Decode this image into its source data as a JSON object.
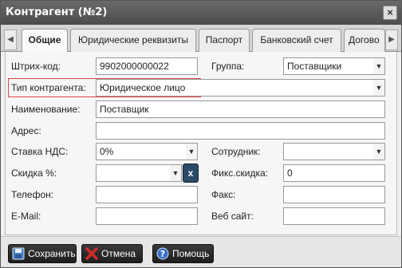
{
  "window": {
    "title": "Контрагент (№2)"
  },
  "tabs": [
    {
      "label": "Общие"
    },
    {
      "label": "Юридические реквизиты"
    },
    {
      "label": "Паспорт"
    },
    {
      "label": "Банковский счет"
    },
    {
      "label": "Догово"
    }
  ],
  "form": {
    "barcode_label": "Штрих-код:",
    "barcode_value": "9902000000022",
    "group_label": "Группа:",
    "group_value": "Поставщики",
    "type_label": "Тип контрагента:",
    "type_value": "Юридическое лицо",
    "name_label": "Наименование:",
    "name_value": "Поставщик",
    "address_label": "Адрес:",
    "address_value": "",
    "vat_label": "Ставка НДС:",
    "vat_value": "0%",
    "employee_label": "Сотрудник:",
    "employee_value": "",
    "discount_label": "Скидка %:",
    "discount_value": "",
    "discount_clear": "x",
    "fixed_discount_label": "Фикс.скидка:",
    "fixed_discount_value": "0",
    "phone_label": "Телефон:",
    "phone_value": "",
    "fax_label": "Факс:",
    "fax_value": "",
    "email_label": "E-Mail:",
    "email_value": "",
    "website_label": "Веб сайт:",
    "website_value": ""
  },
  "footer": {
    "save_label": "Сохранить",
    "cancel_label": "Отмена",
    "help_label": "Помощь"
  },
  "colors": {
    "highlight": "#d94545",
    "save_icon": "#4a7fc1",
    "cancel_icon": "#d42a2a",
    "help_icon": "#3a6fc9"
  },
  "icons": {
    "close": "close-icon",
    "dropdown": "chevron-down-icon",
    "save": "floppy-disk-icon",
    "cancel": "red-x-icon",
    "help": "question-mark-icon"
  }
}
